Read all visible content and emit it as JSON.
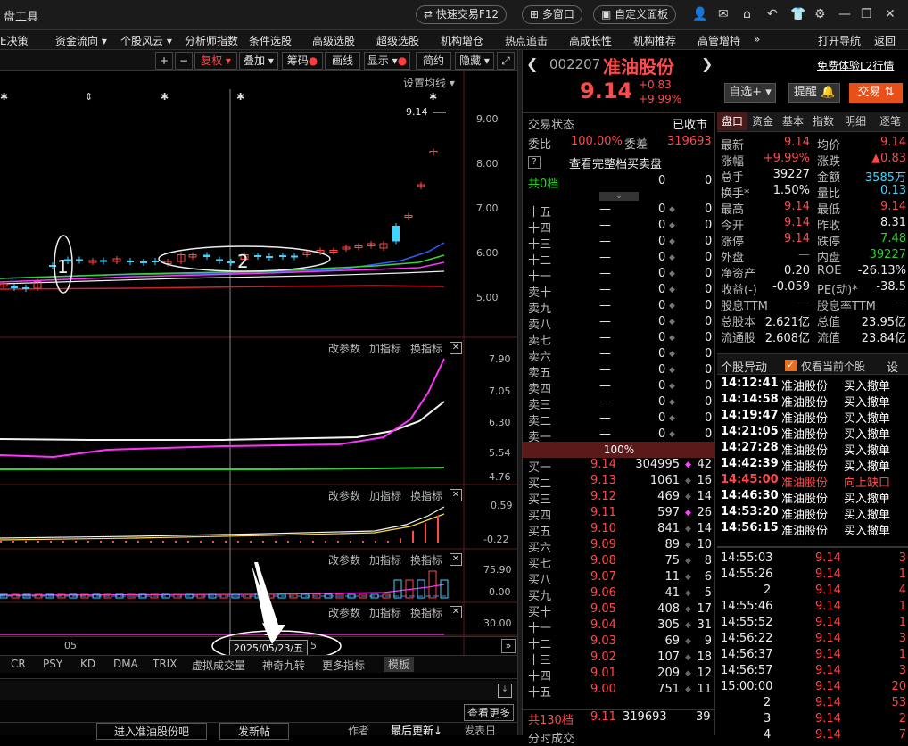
{
  "app": {
    "title": "盘工具",
    "quick_trade": "快速交易F12",
    "multi_window": "多窗口",
    "custom_panel": "自定义面板"
  },
  "menu": [
    "E决策",
    "资金流向 ▾",
    "个股风云 ▾",
    "分析师指数",
    "条件选股",
    "高级选股",
    "超级选股",
    "机构增仓",
    "热点追击",
    "高成长性",
    "机构推荐",
    "高管增持",
    "»",
    "打开导航",
    "返回"
  ],
  "toolbar": {
    "fuquan": "复权",
    "diejia": "叠加",
    "chouma": "筹码",
    "huaxian": "画线",
    "xianshi": "显示",
    "jianyue": "简约",
    "yincang": "隐藏"
  },
  "chart": {
    "set_ma": "设置均线",
    "price_label": "9.14",
    "main_axis": [
      "9.00",
      "8.00",
      "7.00",
      "6.00",
      "5.00"
    ],
    "panel_buttons": [
      "改参数",
      "加指标",
      "换指标"
    ],
    "panel2_axis": [
      "7.90",
      "7.05",
      "6.30",
      "5.54",
      "4.76"
    ],
    "panel3_axis": [
      "0.59",
      "-0.22"
    ],
    "panel4_axis": [
      "75.90",
      "0.00"
    ],
    "panel5_axis": [
      "30.00"
    ],
    "x_label_left": "05",
    "x_label_right": "5",
    "date_label": "2025/05/23/五",
    "annotation_1": "1",
    "annotation_2": "2",
    "indicators": [
      "CR",
      "PSY",
      "KD",
      "DMA",
      "TRIX",
      "虚拟成交量",
      "神奇九转",
      "更多指标",
      "模板"
    ],
    "more": "查看更多",
    "bottom": {
      "enter": "进入准油股份吧",
      "post": "发新帖",
      "author": "作者",
      "updated": "最后更新",
      "publish": "发表日"
    }
  },
  "stock": {
    "code": "002207",
    "name": "准油股份",
    "free_trial": "免费体验L2行情",
    "price": "9.14",
    "change": "+0.83",
    "pct": "+9.99%",
    "btn_watch": "自选",
    "btn_alert": "提醒",
    "btn_trade": "交易",
    "status_label": "交易状态",
    "status_value": "已收市",
    "weibi_label": "委比",
    "weibi_value": "100.00%",
    "weicha_label": "委差",
    "weicha_value": "319693",
    "view_full": "查看完整档买卖盘",
    "sell_total_label": "共0档",
    "sell_total_a": "0",
    "sell_total_b": "0",
    "sell_rows": [
      {
        "n": "十五",
        "p": "—",
        "v": "0",
        "c": "0"
      },
      {
        "n": "十四",
        "p": "—",
        "v": "0",
        "c": "0"
      },
      {
        "n": "十三",
        "p": "—",
        "v": "0",
        "c": "0"
      },
      {
        "n": "十二",
        "p": "—",
        "v": "0",
        "c": "0"
      },
      {
        "n": "十一",
        "p": "—",
        "v": "0",
        "c": "0"
      },
      {
        "n": "卖十",
        "p": "—",
        "v": "0",
        "c": "0"
      },
      {
        "n": "卖九",
        "p": "—",
        "v": "0",
        "c": "0"
      },
      {
        "n": "卖八",
        "p": "—",
        "v": "0",
        "c": "0"
      },
      {
        "n": "卖七",
        "p": "—",
        "v": "0",
        "c": "0"
      },
      {
        "n": "卖六",
        "p": "—",
        "v": "0",
        "c": "0"
      },
      {
        "n": "卖五",
        "p": "—",
        "v": "0",
        "c": "0"
      },
      {
        "n": "卖四",
        "p": "—",
        "v": "0",
        "c": "0"
      },
      {
        "n": "卖三",
        "p": "—",
        "v": "0",
        "c": "0"
      },
      {
        "n": "卖二",
        "p": "—",
        "v": "0",
        "c": "0"
      },
      {
        "n": "卖一",
        "p": "—",
        "v": "0",
        "c": "0"
      }
    ],
    "mid_pct": "100%",
    "buy_rows": [
      {
        "n": "买一",
        "p": "9.14",
        "v": "304995",
        "c": "42",
        "dot": true
      },
      {
        "n": "买二",
        "p": "9.13",
        "v": "1061",
        "c": "16",
        "dot": false
      },
      {
        "n": "买三",
        "p": "9.12",
        "v": "469",
        "c": "14",
        "dot": false
      },
      {
        "n": "买四",
        "p": "9.11",
        "v": "597",
        "c": "26",
        "dot": true
      },
      {
        "n": "买五",
        "p": "9.10",
        "v": "841",
        "c": "14",
        "dot": false
      },
      {
        "n": "买六",
        "p": "9.09",
        "v": "89",
        "c": "10",
        "dot": false
      },
      {
        "n": "买七",
        "p": "9.08",
        "v": "75",
        "c": "8",
        "dot": false
      },
      {
        "n": "买八",
        "p": "9.07",
        "v": "11",
        "c": "6",
        "dot": false
      },
      {
        "n": "买九",
        "p": "9.06",
        "v": "41",
        "c": "5",
        "dot": false
      },
      {
        "n": "买十",
        "p": "9.05",
        "v": "408",
        "c": "17",
        "dot": false
      },
      {
        "n": "十一",
        "p": "9.04",
        "v": "305",
        "c": "31",
        "dot": false
      },
      {
        "n": "十二",
        "p": "9.03",
        "v": "69",
        "c": "9",
        "dot": false
      },
      {
        "n": "十三",
        "p": "9.02",
        "v": "107",
        "c": "18",
        "dot": false
      },
      {
        "n": "十四",
        "p": "9.01",
        "v": "209",
        "c": "12",
        "dot": false
      },
      {
        "n": "十五",
        "p": "9.00",
        "v": "751",
        "c": "11",
        "dot": false
      }
    ],
    "buy_total_label": "共130档",
    "buy_total_p": "9.11",
    "buy_total_v": "319693",
    "buy_total_c": "39",
    "tabs": [
      "盘口",
      "资金",
      "基本",
      "指数",
      "明细",
      "逐笔"
    ],
    "quote": [
      [
        "最新",
        "9.14",
        "均价",
        "9.14"
      ],
      [
        "涨幅",
        "+9.99%",
        "涨跌",
        "▲0.83"
      ],
      [
        "总手",
        "39227",
        "金额",
        "3585万"
      ],
      [
        "换手*",
        "1.50%",
        "量比",
        "0.13"
      ],
      [
        "最高",
        "9.14",
        "最低",
        "9.14"
      ],
      [
        "今开",
        "9.14",
        "昨收",
        "8.31"
      ],
      [
        "涨停",
        "9.14",
        "跌停",
        "7.48"
      ],
      [
        "外盘",
        "—",
        "内盘",
        "39227"
      ],
      [
        "净资产",
        "0.20",
        "ROE",
        "-26.13%"
      ],
      [
        "收益(-)",
        "-0.059",
        "PE(动)*",
        "-38.5"
      ],
      [
        "股息TTM",
        "—",
        "股息率TTM",
        "—"
      ],
      [
        "总股本",
        "2.621亿",
        "总值",
        "23.95亿"
      ],
      [
        "流通股",
        "2.608亿",
        "流值",
        "23.84亿"
      ]
    ],
    "anomaly_title": "个股异动",
    "anomaly_only": "仅看当前个股",
    "anomaly_set": "设",
    "anomaly": [
      [
        "14:12:41",
        "准油股份",
        "买入撤单"
      ],
      [
        "14:14:58",
        "准油股份",
        "买入撤单"
      ],
      [
        "14:19:47",
        "准油股份",
        "买入撤单"
      ],
      [
        "14:21:05",
        "准油股份",
        "买入撤单"
      ],
      [
        "14:27:28",
        "准油股份",
        "买入撤单"
      ],
      [
        "14:42:39",
        "准油股份",
        "买入撤单"
      ],
      [
        "14:45:00",
        "准油股份",
        "向上缺口"
      ],
      [
        "14:46:30",
        "准油股份",
        "买入撤单"
      ],
      [
        "14:53:20",
        "准油股份",
        "买入撤单"
      ],
      [
        "14:56:15",
        "准油股份",
        "买入撤单"
      ]
    ],
    "ticks": [
      [
        "14:55:03",
        "9.14",
        "3"
      ],
      [
        "14:55:26",
        "9.14",
        "1"
      ],
      [
        "2",
        "9.14",
        "4"
      ],
      [
        "14:55:46",
        "9.14",
        "1"
      ],
      [
        "14:55:52",
        "9.14",
        "1"
      ],
      [
        "14:56:22",
        "9.14",
        "3"
      ],
      [
        "14:56:37",
        "9.14",
        "1"
      ],
      [
        "14:56:57",
        "9.14",
        "3"
      ],
      [
        "15:00:00",
        "9.14",
        "20"
      ],
      [
        "2",
        "9.14",
        "53"
      ],
      [
        "3",
        "9.14",
        "2"
      ],
      [
        "4",
        "9.14",
        "7"
      ]
    ],
    "time_label": "分时成交"
  }
}
